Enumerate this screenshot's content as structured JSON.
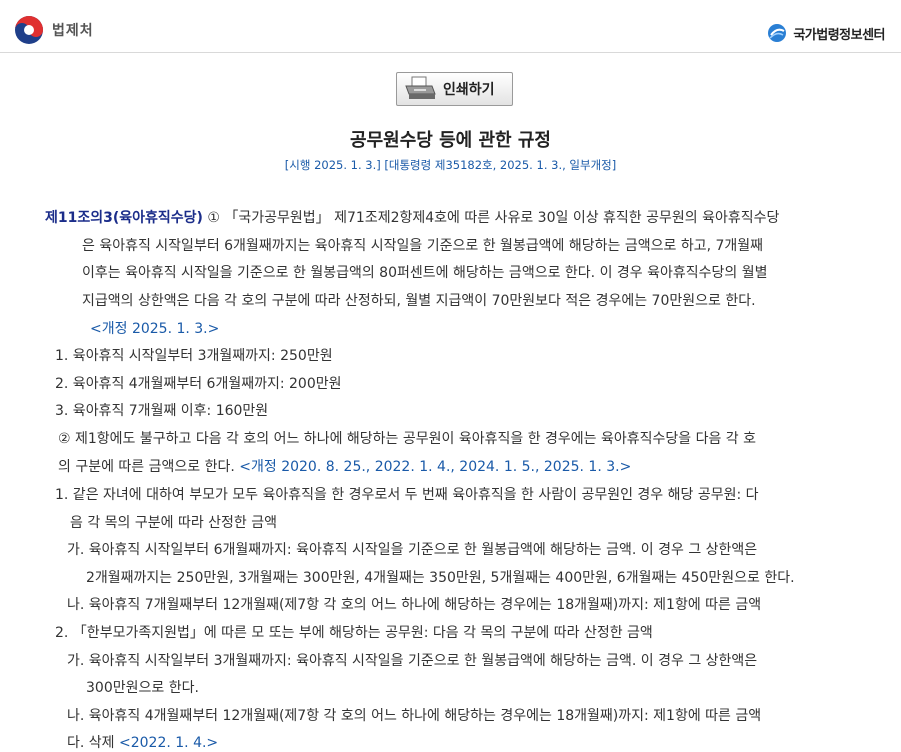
{
  "header": {
    "left_org": "법제처",
    "right_org": "국가법령정보센터"
  },
  "print_button": {
    "label": "인쇄하기"
  },
  "document": {
    "title": "공무원수당 등에 관한 규정",
    "subtitle": "[시행 2025. 1. 3.] [대통령령 제35182호, 2025. 1. 3., 일부개정]",
    "article_title": "제11조의3(육아휴직수당)",
    "para1": [
      "① 「국가공무원법」 제71조제2항제4호에 따른 사유로 30일 이상 휴직한 공무원의 육아휴직수당",
      "은 육아휴직 시작일부터 6개월째까지는 육아휴직 시작일을 기준으로 한 월봉급액에 해당하는 금액으로 하고, 7개월째",
      "이후는 육아휴직 시작일을 기준으로 한 월봉급액의 80퍼센트에 해당하는 금액으로 한다. 이 경우 육아휴직수당의 월별",
      "지급액의 상한액은 다음 각 호의 구분에 따라 산정하되, 월별 지급액이 70만원보다 적은 경우에는 70만원으로 한다."
    ],
    "para1_amend": "<개정 2025. 1. 3.>",
    "items1": [
      "1. 육아휴직 시작일부터 3개월째까지: 250만원",
      "2. 육아휴직 4개월째부터 6개월째까지: 200만원",
      "3. 육아휴직 7개월째 이후: 160만원"
    ],
    "para2_line1": "② 제1항에도 불구하고 다음 각 호의 어느 하나에 해당하는 공무원이 육아휴직을 한 경우에는 육아휴직수당을 다음 각 호",
    "para2_line2": "의 구분에 따른 금액으로 한다.",
    "para2_amend": "<개정 2020. 8. 25., 2022. 1. 4., 2024. 1. 5., 2025. 1. 3.>",
    "item2_1": [
      "1. 같은 자녀에 대하여 부모가 모두 육아휴직을 한 경우로서 두 번째 육아휴직을 한 사람이 공무원인 경우 해당 공무원: 다",
      "음 각 목의 구분에 따라 산정한 금액"
    ],
    "item2_1_ga": [
      "가. 육아휴직 시작일부터 6개월째까지: 육아휴직 시작일을 기준으로 한 월봉급액에 해당하는 금액. 이 경우 그 상한액은",
      "2개월째까지는 250만원, 3개월째는 300만원, 4개월째는 350만원, 5개월째는 400만원, 6개월째는 450만원으로 한다."
    ],
    "item2_1_na": "나. 육아휴직 7개월째부터 12개월째(제7항 각 호의 어느 하나에 해당하는 경우에는 18개월째)까지: 제1항에 따른 금액",
    "item2_2": "2. 「한부모가족지원법」에 따른 모 또는 부에 해당하는 공무원: 다음 각 목의 구분에 따라 산정한 금액",
    "item2_2_ga": [
      "가. 육아휴직 시작일부터 3개월째까지: 육아휴직 시작일을 기준으로 한 월봉급액에 해당하는 금액. 이 경우 그 상한액은",
      "300만원으로 한다."
    ],
    "item2_2_na": "나. 육아휴직 4개월째부터 12개월째(제7항 각 호의 어느 하나에 해당하는 경우에는 18개월째)까지: 제1항에 따른 금액",
    "item2_2_da": "다. 삭제",
    "item2_2_da_amend": "<2022. 1. 4.>"
  }
}
